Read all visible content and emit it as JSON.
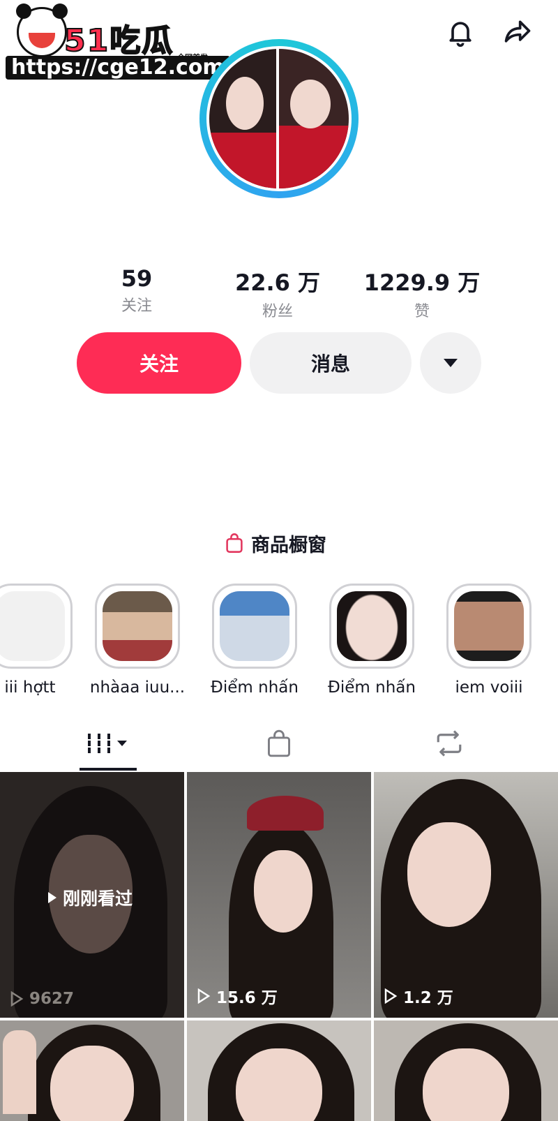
{
  "watermark": {
    "logo": "51吃瓜",
    "tag": "全网首发",
    "url": "https://cge12.com"
  },
  "header": {
    "bell_icon": "bell-icon",
    "share_icon": "share-icon"
  },
  "stats": [
    {
      "value": "59",
      "label": "关注"
    },
    {
      "value": "22.6 万",
      "label": "粉丝"
    },
    {
      "value": "1229.9 万",
      "label": "赞"
    }
  ],
  "actions": {
    "follow": "关注",
    "message": "消息"
  },
  "shop": {
    "label": "商品橱窗"
  },
  "highlights": [
    {
      "label": "iii hợtt"
    },
    {
      "label": "nhàaa iuu..."
    },
    {
      "label": "Điểm nhấn"
    },
    {
      "label": "Điểm nhấn"
    },
    {
      "label": "iem voiii"
    }
  ],
  "tabs": [
    "videos-tab",
    "shop-tab",
    "repost-tab"
  ],
  "videos": [
    {
      "views": "9627",
      "badge": "刚刚看过"
    },
    {
      "views": "15.6 万"
    },
    {
      "views": "1.2 万"
    },
    {
      "views": ""
    },
    {
      "views": ""
    },
    {
      "views": ""
    }
  ],
  "colors": {
    "accent": "#fe2c55",
    "ring": "#1ec8d8",
    "secondary": "#f1f1f2"
  }
}
